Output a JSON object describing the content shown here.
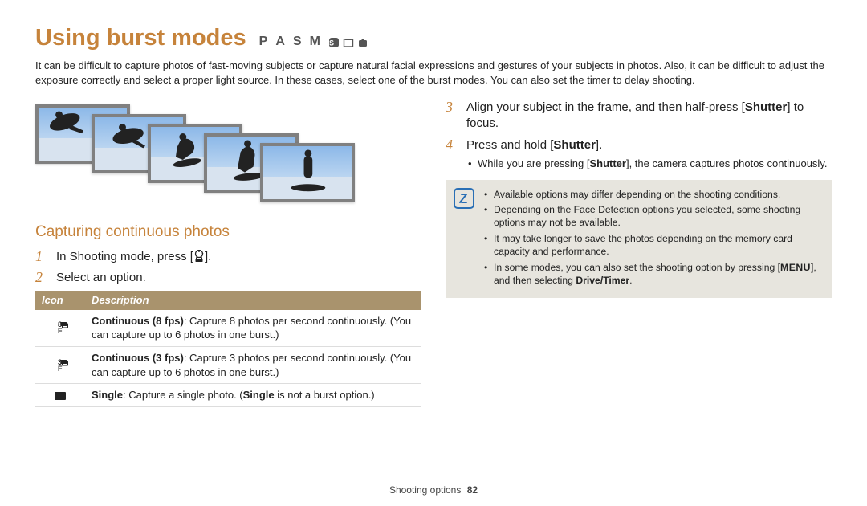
{
  "title": "Using burst modes",
  "mode_letters": [
    "P",
    "A",
    "S",
    "M"
  ],
  "intro": "It can be difficult to capture photos of fast-moving subjects or capture natural facial expressions and gestures of your subjects in photos. Also, it can be difficult to adjust the exposure correctly and select a proper light source. In these cases, select one of the burst modes. You can also set the timer to delay shooting.",
  "section_heading": "Capturing continuous photos",
  "steps_left": {
    "s1": "In Shooting mode, press [",
    "s1_tail": "].",
    "s2": "Select an option."
  },
  "table": {
    "hdr_icon": "Icon",
    "hdr_desc": "Description",
    "rows": [
      {
        "icon_text": "8",
        "name": "Continuous (8 fps)",
        "desc": ": Capture 8 photos per second continuously. (You can capture up to 6 photos in one burst.)"
      },
      {
        "icon_text": "3",
        "name": "Continuous (3 fps)",
        "desc": ": Capture 3 photos per second continuously. (You can capture up to 6 photos in one burst.)"
      },
      {
        "icon_text": "",
        "name": "Single",
        "desc_pre": ": Capture a single photo. (",
        "desc_bold": "Single",
        "desc_post": " is not a burst option.)"
      }
    ]
  },
  "steps_right": {
    "s3_pre": "Align your subject in the frame, and then half-press [",
    "s3_bold": "Shutter",
    "s3_post": "] to focus.",
    "s4_pre": "Press and hold [",
    "s4_bold": "Shutter",
    "s4_post": "].",
    "s4_sub_pre": "While you are pressing [",
    "s4_sub_bold": "Shutter",
    "s4_sub_post": "], the camera captures photos continuously."
  },
  "note": {
    "n1": "Available options may differ depending on the shooting conditions.",
    "n2": "Depending on the Face Detection options you selected, some shooting options may not be available.",
    "n3": "It may take longer to save the photos depending on the memory card capacity and performance.",
    "n4_pre": "In some modes, you can also set the shooting option by pressing [",
    "n4_menu": "MENU",
    "n4_mid": "], and then selecting ",
    "n4_bold": "Drive/Timer",
    "n4_post": "."
  },
  "footer": {
    "section": "Shooting options",
    "page": "82"
  }
}
